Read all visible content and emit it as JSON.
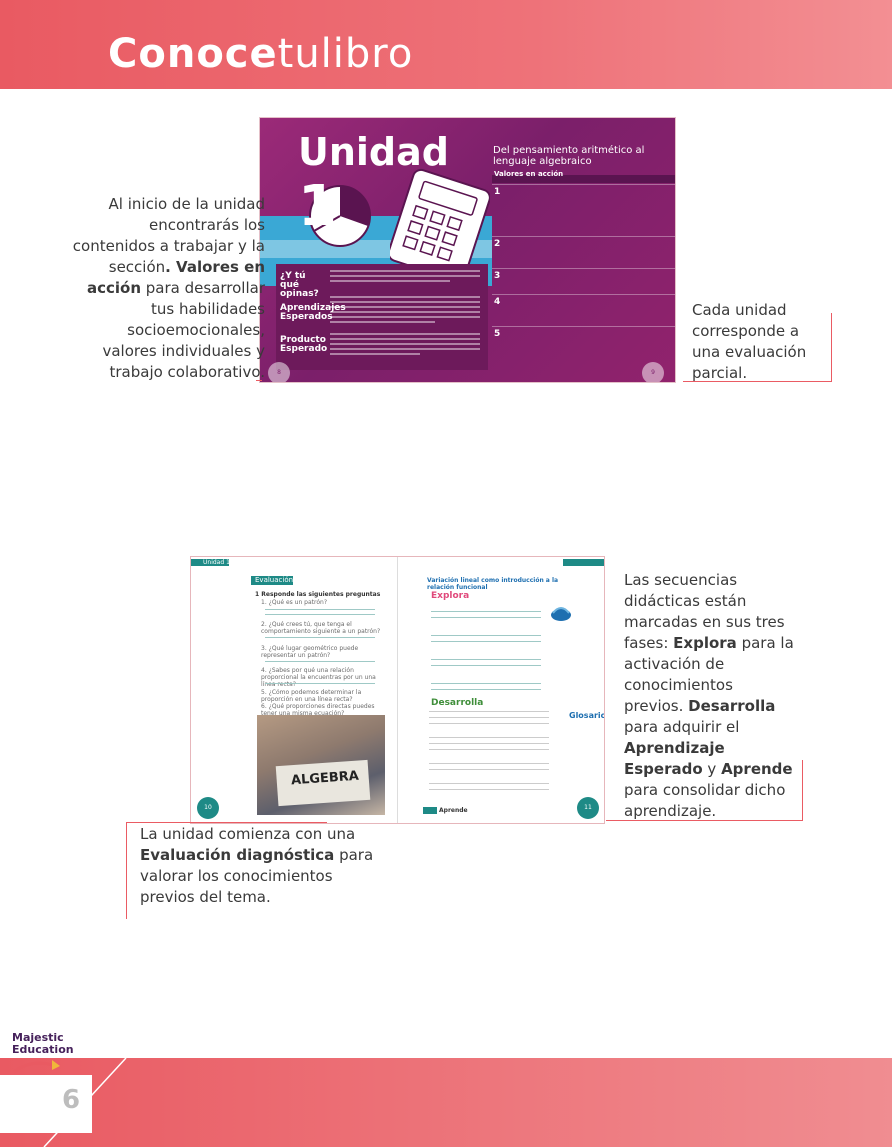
{
  "header": {
    "title_bold": "Conoce",
    "title_light": "tulibro"
  },
  "footer": {
    "page_number": "6",
    "logo_line1": "Majestic",
    "logo_line2": "Education"
  },
  "spread_unit": {
    "unit_word": "Unidad",
    "unit_number": "1",
    "subtitle": "Del pensamiento aritmético al lenguaje algebraico",
    "valores_label": "Valores en acción",
    "left_labels": [
      "¿Y tú qué opinas?",
      "Aprendizajes Esperados",
      "Producto Esperado"
    ],
    "rows": [
      "1",
      "2",
      "3",
      "4",
      "5"
    ],
    "page_left": "8",
    "page_right": "9"
  },
  "spread_sequence": {
    "left_header": "Unidad 1",
    "left_tab": "Evaluación diagnóstica",
    "left_instruction": "1 Responde las siguientes preguntas",
    "questions": [
      "1. ¿Qué es un patrón?",
      "2. ¿Qué crees tú, que tenga el comportamiento siguiente a un patrón?",
      "3. ¿Qué lugar geométrico puede representar un patrón?",
      "4. ¿Sabes por qué una relación proporcional la encuentras por un una línea recta?",
      "5. ¿Cómo podemos determinar la proporción en una línea recta?",
      "6. ¿Qué proporciones directas puedes tener una misma ecuación?"
    ],
    "photo_word": "ALGEBRA",
    "right_title": "Variación lineal como introducción a la relación funcional",
    "explora": "Explora",
    "desarrolla": "Desarrolla",
    "glosario": "Glosario",
    "aprende": "Aprende",
    "page_left": "10",
    "page_right": "11"
  },
  "callouts": {
    "c1_a": "Al inicio de la unidad encontrarás los contenidos a trabajar y la sección",
    "c1_bold": ". Valores en acción",
    "c1_b": " para desarrollar tus habilidades socioemocionales, valores individuales y trabajo colaborativo.",
    "c2": "Cada unidad corresponde a una evaluación parcial.",
    "c3_a": "Las secuencias didácticas están marcadas en sus tres fases: ",
    "c3_b1": "Explora",
    "c3_c": " para la activación de conocimientos previos. ",
    "c3_b2": "Desarrolla",
    "c3_d": " para adquirir el ",
    "c3_b3": "Aprendizaje Esperado",
    "c3_e": " y ",
    "c3_b4": "Aprende",
    "c3_f": " para consolidar dicho aprendizaje.",
    "c4_a": "La unidad comienza con una ",
    "c4_bold": "Evaluación diagnóstica",
    "c4_b": " para valorar los conocimientos previos del tema."
  },
  "colors": {
    "accent_red": "#ea5b63",
    "unit_purple": "#8a2470",
    "teal": "#1e8a86"
  }
}
